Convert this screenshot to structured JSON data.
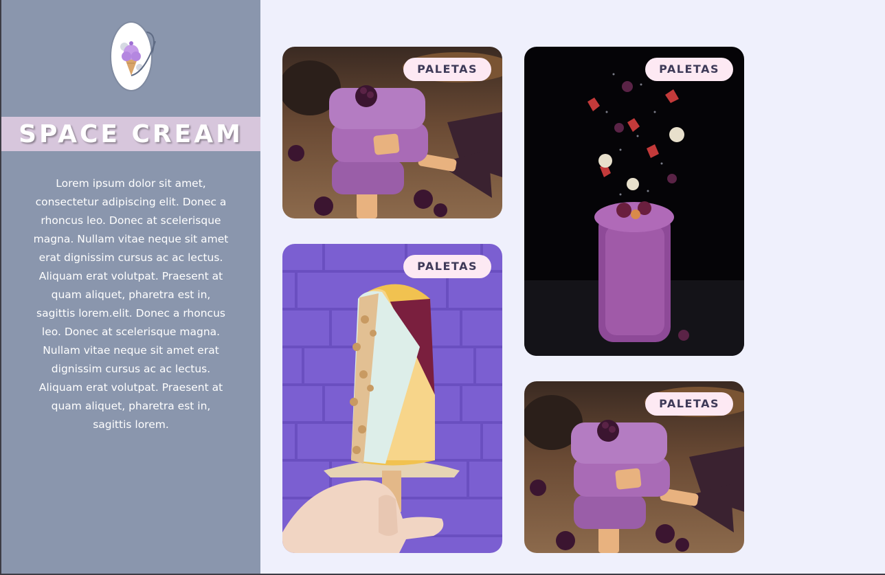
{
  "sidebar": {
    "logo_icon": "ice-cream-planet-icon",
    "brand_title": "SPACE CREAM",
    "description_lines": [
      "Lorem ipsum dolor sit amet,",
      "consectetur adipiscing elit. Donec a",
      "rhoncus leo. Donec at scelerisque",
      "magna. Nullam vitae neque sit amet",
      "erat dignissim cursus ac ac lectus.",
      "Aliquam erat volutpat. Praesent at",
      "quam aliquet, pharetra est in,",
      "sagittis lorem.elit. Donec a rhoncus",
      "leo. Donec at scelerisque magna.",
      "Nullam vitae neque sit amet erat",
      "dignissim cursus ac ac lectus.",
      "Aliquam erat volutpat. Praesent at",
      "quam aliquet, pharetra est in,",
      "sagittis lorem."
    ]
  },
  "gallery": {
    "cards": [
      {
        "badge": "PALETAS",
        "photo": "stacked-berry-popsicles"
      },
      {
        "badge": "PALETAS",
        "photo": "berry-smoothie-jar-with-falling-fruit"
      },
      {
        "badge": "PALETAS",
        "photo": "nut-coated-popsicle-in-hand"
      },
      {
        "badge": "PALETAS",
        "photo": "stacked-berry-popsicles"
      }
    ]
  },
  "colors": {
    "sidebar_bg": "#8a96ad",
    "brand_band": "#d7c6dc",
    "page_bg": "#eff0fc",
    "badge_bg": "#fde9f3",
    "badge_text": "#3e3a58"
  }
}
